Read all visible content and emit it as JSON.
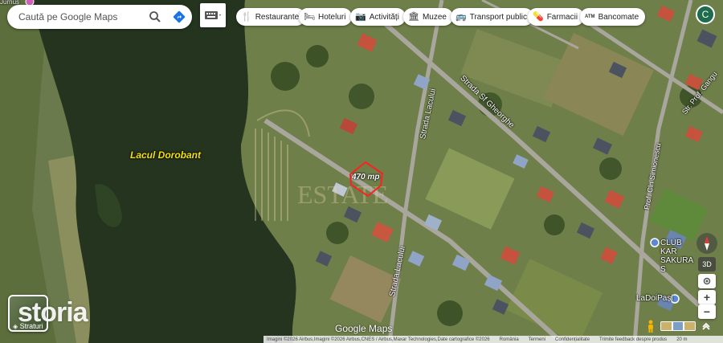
{
  "search": {
    "placeholder": "Caută pe Google Maps"
  },
  "chips": [
    {
      "label": "Restaurante",
      "icon": "fork-knife-icon"
    },
    {
      "label": "Hoteluri",
      "icon": "bed-icon"
    },
    {
      "label": "Activități",
      "icon": "camera-icon"
    },
    {
      "label": "Muzee",
      "icon": "museum-icon"
    },
    {
      "label": "Transport public",
      "icon": "bus-icon"
    },
    {
      "label": "Farmacii",
      "icon": "pill-icon"
    },
    {
      "label": "Bancomate",
      "icon": "atm-icon"
    }
  ],
  "avatar": {
    "initial": "C"
  },
  "map": {
    "lake_label": "Lacul Dorobant",
    "parcel_label": "470 mp",
    "streets": {
      "sf_gheorghe": "Strada Sf Gheorghe",
      "lacului_upper": "Strada Lacului",
      "lacului_lower": "Strada Lacului",
      "prof_gangu": "Str. Prof. Gangu",
      "prof_simionescu": "Prof. Cln Simionescu"
    },
    "poi": {
      "club_name": "CLUB KAR SAKURA S",
      "ladoipasi": "LaDoiPași"
    },
    "top_cut_label": "Jurnus"
  },
  "watermark": {
    "brand": "storia"
  },
  "layers": {
    "label": "Straturi"
  },
  "controls": {
    "btn3d": "3D"
  },
  "google_logo": "Google Maps",
  "attribution": {
    "imagery": "Imagini ©2026 Airbus,Imagini ©2026 Airbus,CNES / Airbus,Maxar Technologies,Date cartografice ©2026",
    "country": "România",
    "terms": "Termeni",
    "privacy": "Confidențialitate",
    "feedback": "Trimite feedback despre produs",
    "scale": "20 m"
  },
  "colors": {
    "lake": "#24341f",
    "vegetation": "#55683d",
    "road": "#a9a79d",
    "parcel_outline": "#ff2020",
    "lake_label": "#f7e300",
    "avatar": "#1e6b4d"
  }
}
